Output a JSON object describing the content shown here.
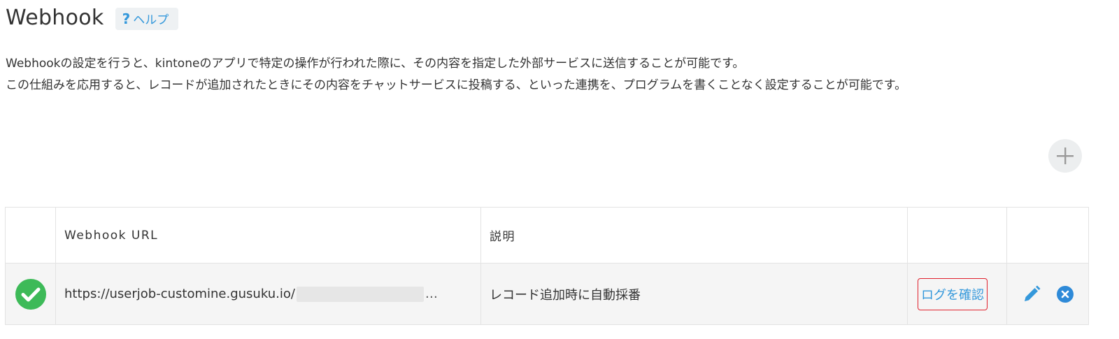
{
  "header": {
    "title": "Webhook",
    "help_icon": "?",
    "help_label": "ヘルプ"
  },
  "description": {
    "line1": "Webhookの設定を行うと、kintoneのアプリで特定の操作が行われた際に、その内容を指定した外部サービスに送信することが可能です。",
    "line2": "この仕組みを応用すると、レコードが追加されたときにその内容をチャットサービスに投稿する、といった連携を、プログラムを書くことなく設定することが可能です。"
  },
  "add_button": {
    "icon": "plus-icon"
  },
  "table": {
    "headers": {
      "status": "",
      "url": "Webhook URL",
      "description": "説明",
      "log": "",
      "actions": ""
    },
    "rows": [
      {
        "status_icon": "check-circle-icon",
        "url": "https://userjob-customine.gusuku.io/",
        "url_truncation": "…",
        "description": "レコード追加時に自動採番",
        "log_label": "ログを確認",
        "edit_icon": "pencil-icon",
        "delete_icon": "close-circle-icon"
      }
    ]
  },
  "colors": {
    "accent_blue": "#3498db",
    "status_green": "#3dba58",
    "highlight_red": "#e0202d",
    "row_background": "#f5f5f5"
  }
}
